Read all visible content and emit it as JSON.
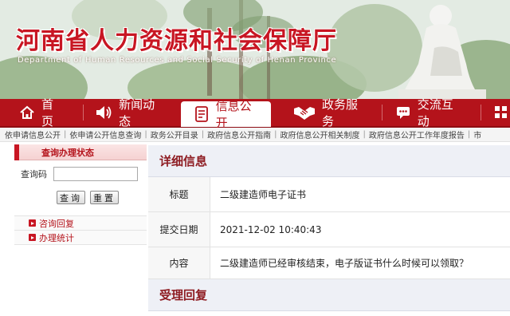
{
  "header": {
    "title": "河南省人力资源和社会保障厅",
    "subtitle": "Department of Human Resources and Social Security of Henan Province"
  },
  "nav": {
    "items": [
      {
        "label": "首页",
        "icon": "home-icon"
      },
      {
        "label": "新闻动态",
        "icon": "speaker-icon"
      },
      {
        "label": "信息公开",
        "icon": "document-icon"
      },
      {
        "label": "政务服务",
        "icon": "handshake-icon"
      },
      {
        "label": "交流互动",
        "icon": "chat-icon"
      }
    ],
    "active_index": 2
  },
  "subnav": {
    "links": [
      "依申请信息公开",
      "依申请公开信息查询",
      "政务公开目录",
      "政府信息公开指南",
      "政府信息公开相关制度",
      "政府信息公开工作年度报告",
      "市"
    ]
  },
  "sidebar": {
    "heading": "查询办理状态",
    "query_label": "查询码",
    "query_value": "",
    "query_button": "查询",
    "reset_button": "重置",
    "links": [
      "咨询回复",
      "办理统计"
    ]
  },
  "detail": {
    "section_title": "详细信息",
    "rows": [
      {
        "key": "标题",
        "value": "二级建造师电子证书"
      },
      {
        "key": "提交日期",
        "value": "2021-12-02 10:40:43"
      },
      {
        "key": "内容",
        "value": "二级建造师已经审核结束，电子版证书什么时候可以领取？"
      }
    ],
    "reply_title": "受理回复"
  },
  "colors": {
    "brand_red": "#b4131b",
    "title_red": "#c81623",
    "section_bg": "#eef0f6"
  }
}
